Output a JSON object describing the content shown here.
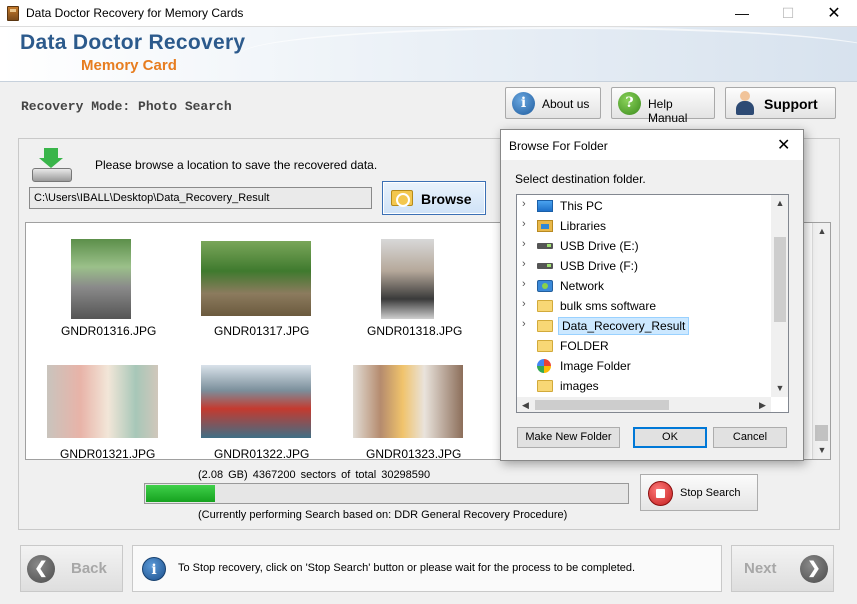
{
  "window": {
    "title": "Data Doctor Recovery for Memory Cards",
    "minimize": "—",
    "maximize": "☐",
    "close": "✕"
  },
  "banner": {
    "brand_line1": "Data Doctor Recovery",
    "brand_line2": "Memory Card"
  },
  "mode": {
    "label": "Recovery Mode: Photo Search"
  },
  "top_buttons": {
    "about": "About us",
    "help": "Help Manual",
    "support": "Support",
    "about_icon": "i",
    "help_icon": "?"
  },
  "location": {
    "message": "Please browse a location to save the recovered data.",
    "path": "C:\\Users\\IBALL\\Desktop\\Data_Recovery_Result",
    "browse_label": "Browse"
  },
  "gallery": {
    "items": [
      {
        "file": "GNDR01316.JPG"
      },
      {
        "file": "GNDR01317.JPG"
      },
      {
        "file": "GNDR01318.JPG"
      },
      {
        "file": "GNDR01321.JPG"
      },
      {
        "file": "GNDR01322.JPG"
      },
      {
        "file": "GNDR01323.JPG"
      }
    ]
  },
  "progress": {
    "sectors_text": "(2.08 GB) 4367200  sectors  of  total 30298590",
    "sectors_done": 4367200,
    "sectors_total": 30298590,
    "procedure_text": "(Currently performing Search based on:  DDR General Recovery Procedure)",
    "stop_label": "Stop Search"
  },
  "footer": {
    "back_label": "Back",
    "next_label": "Next",
    "back_arrow": "❮",
    "next_arrow": "❯",
    "info_icon": "i",
    "info_text": "To Stop recovery, click on 'Stop Search' button or please wait for the process to be completed."
  },
  "dialog": {
    "title": "Browse For Folder",
    "close": "✕",
    "prompt": "Select destination folder.",
    "tree": [
      {
        "label": "This PC",
        "icon": "pc-icon",
        "expandable": true
      },
      {
        "label": "Libraries",
        "icon": "library-icon",
        "expandable": true
      },
      {
        "label": "USB Drive (E:)",
        "icon": "usb-drive-icon",
        "expandable": true
      },
      {
        "label": "USB Drive (F:)",
        "icon": "usb-drive-icon",
        "expandable": true
      },
      {
        "label": "Network",
        "icon": "network-icon",
        "expandable": true
      },
      {
        "label": "bulk sms software",
        "icon": "folder-icon",
        "expandable": true
      },
      {
        "label": "Data_Recovery_Result",
        "icon": "folder-icon",
        "expandable": true,
        "selected": true
      },
      {
        "label": "FOLDER",
        "icon": "folder-icon",
        "expandable": false
      },
      {
        "label": "Image Folder",
        "icon": "image-folder-icon",
        "expandable": false
      },
      {
        "label": "images",
        "icon": "folder-icon",
        "expandable": false
      }
    ],
    "chevron": "›",
    "new_folder_label": "Make New Folder",
    "ok_label": "OK",
    "cancel_label": "Cancel"
  },
  "scroll_arrows": {
    "up": "▲",
    "down": "▼",
    "left": "◀",
    "right": "▶"
  }
}
